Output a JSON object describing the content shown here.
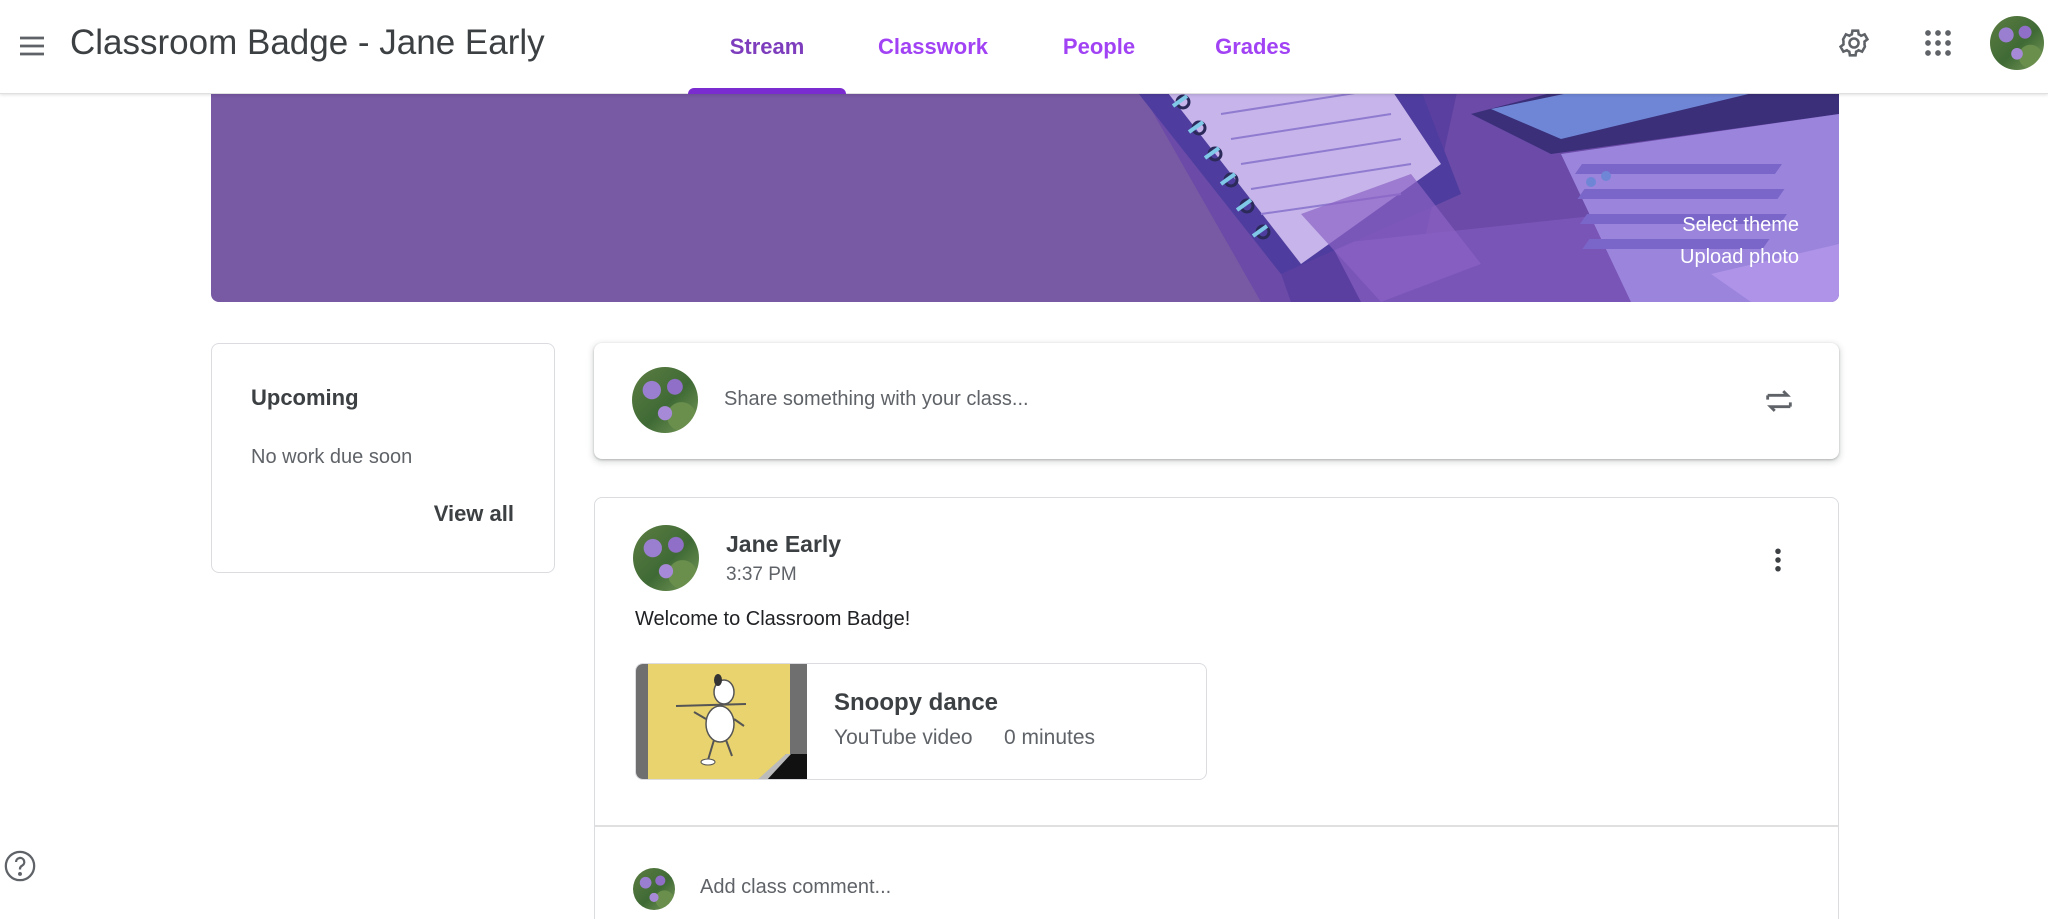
{
  "header": {
    "title": "Classroom Badge - Jane Early",
    "tabs": [
      {
        "label": "Stream",
        "active": true
      },
      {
        "label": "Classwork",
        "active": false
      },
      {
        "label": "People",
        "active": false
      },
      {
        "label": "Grades",
        "active": false
      }
    ],
    "icons": {
      "menu": "hamburger-menu-icon",
      "settings": "gear-icon",
      "apps": "apps-grid-icon"
    }
  },
  "banner": {
    "select_theme": "Select theme",
    "upload_photo": "Upload photo",
    "color": "#7759a4"
  },
  "upcoming": {
    "title": "Upcoming",
    "empty_text": "No work due soon",
    "view_all": "View all"
  },
  "share": {
    "placeholder": "Share something with your class..."
  },
  "post": {
    "author": "Jane Early",
    "time": "3:37 PM",
    "text": "Welcome to Classroom Badge!",
    "attachment": {
      "title": "Snoopy dance",
      "type": "YouTube video",
      "duration": "0 minutes"
    },
    "comment_placeholder": "Add class comment..."
  },
  "colors": {
    "accent": "#7b2cd0",
    "tab_text": "#a142f4"
  }
}
